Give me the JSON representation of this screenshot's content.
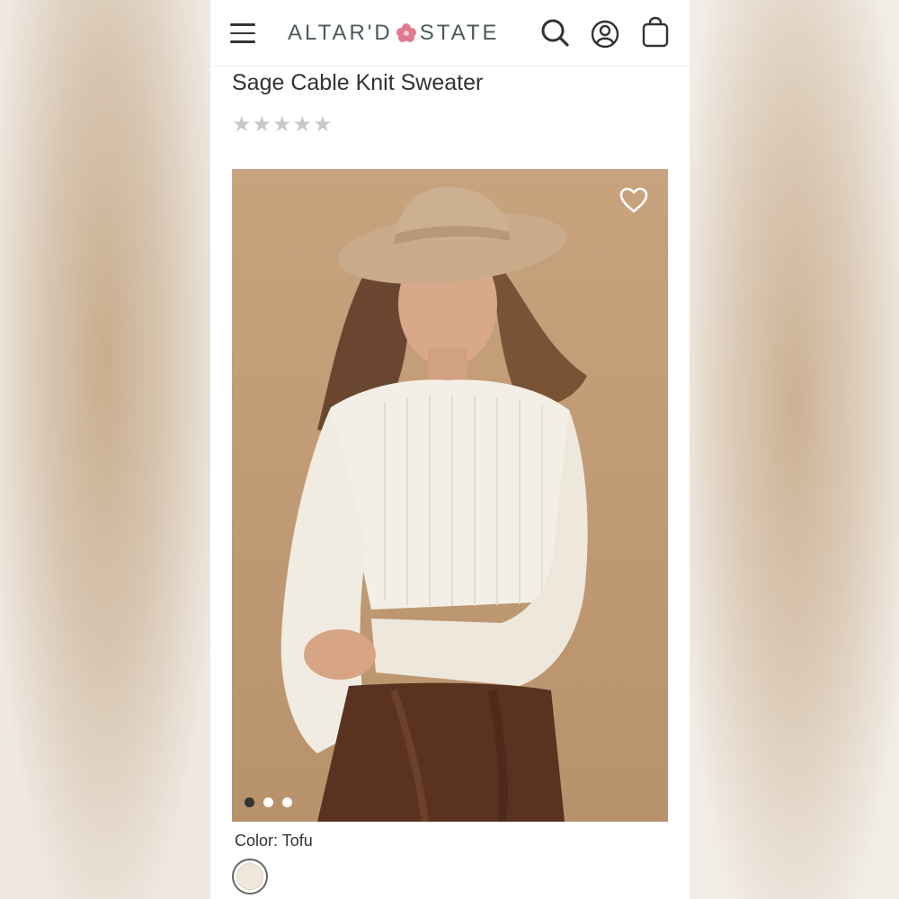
{
  "header": {
    "logo_left": "ALTAR'D",
    "logo_right": "STATE"
  },
  "product": {
    "title": "Sage Cable Knit Sweater",
    "rating_stars": "★★★★★",
    "rating_value": 0,
    "rating_max": 5
  },
  "gallery": {
    "image_count": 3,
    "active_index": 0
  },
  "color": {
    "label": "Color: Tofu",
    "swatch_color": "#efe8da"
  },
  "colors": {
    "star_empty": "#c8c8c8",
    "logo": "#4a5a56",
    "logo_flower": "#e07a8e"
  }
}
